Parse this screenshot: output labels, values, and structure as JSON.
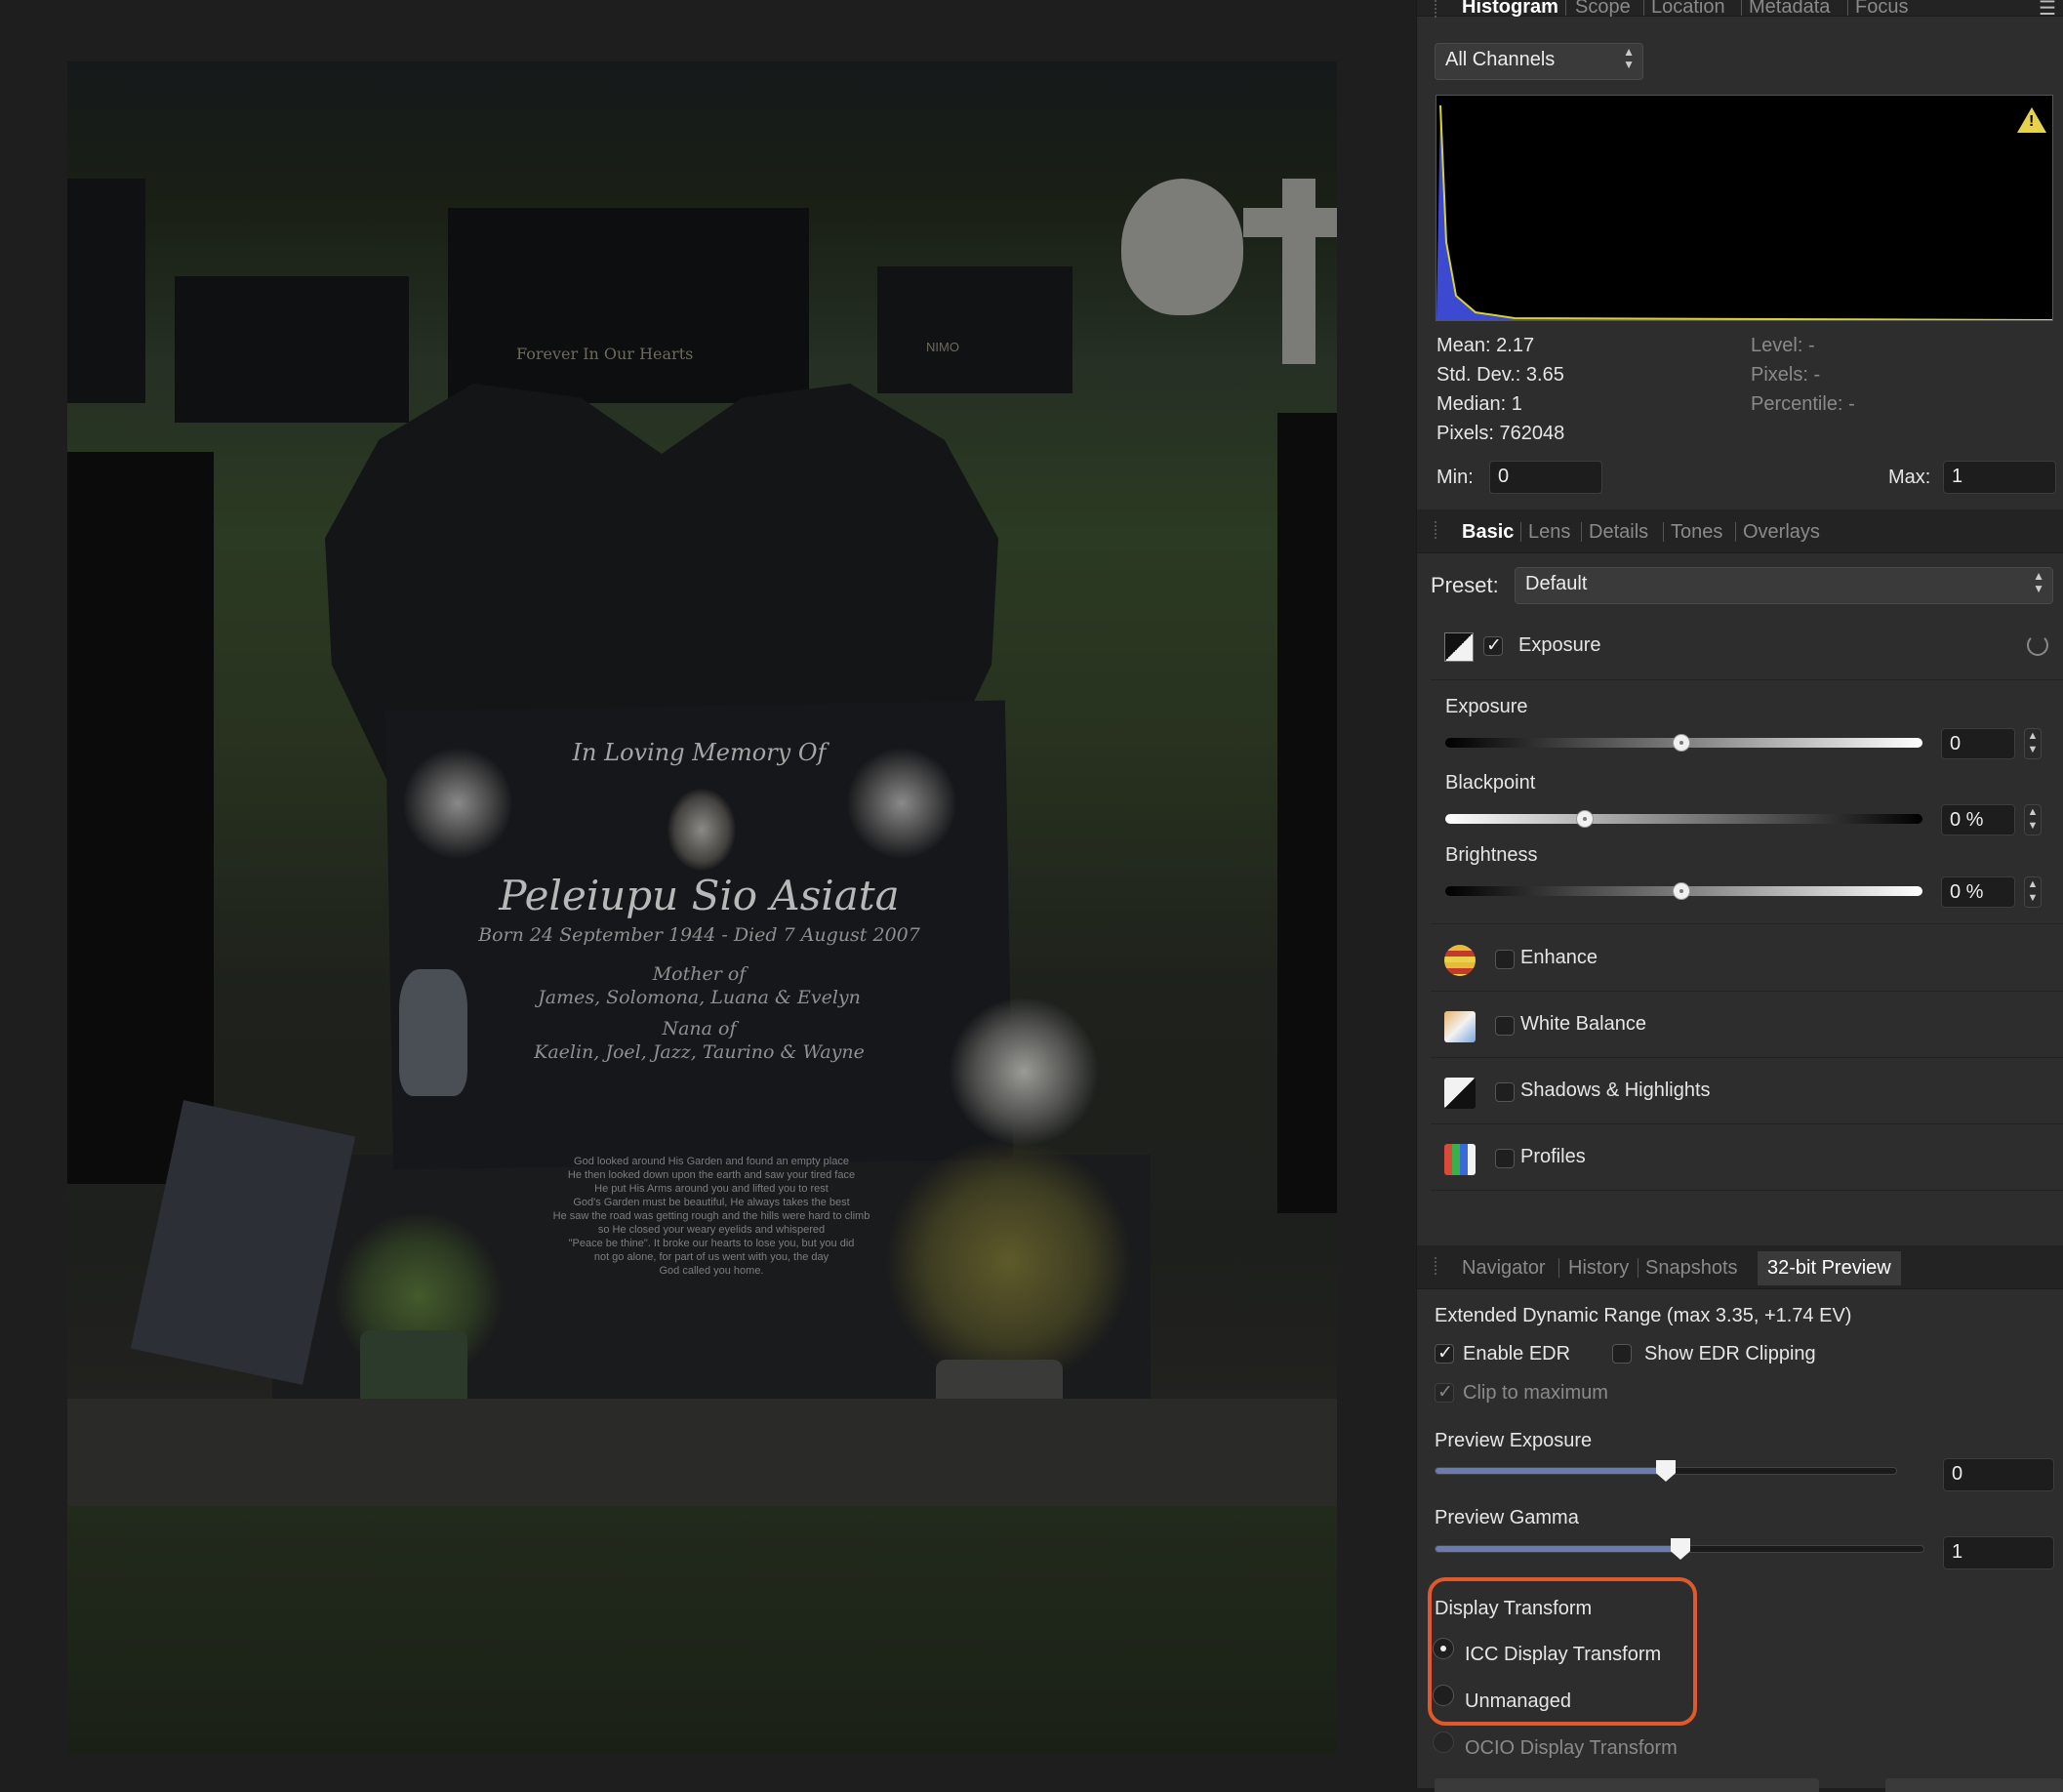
{
  "histogram": {
    "tabs": [
      "Histogram",
      "Scope",
      "Location",
      "Metadata",
      "Focus"
    ],
    "channel": "All Channels",
    "stats_left": [
      {
        "label": "Mean:",
        "value": "2.17"
      },
      {
        "label": "Std. Dev.:",
        "value": "3.65"
      },
      {
        "label": "Median:",
        "value": "1"
      },
      {
        "label": "Pixels:",
        "value": "762048"
      }
    ],
    "stats_right": [
      {
        "label": "Level:",
        "value": "-"
      },
      {
        "label": "Pixels:",
        "value": "-"
      },
      {
        "label": "Percentile:",
        "value": "-"
      }
    ],
    "min_label": "Min:",
    "min_value": "0",
    "max_label": "Max:",
    "max_value": "1"
  },
  "develop": {
    "tabs": [
      "Basic",
      "Lens",
      "Details",
      "Tones",
      "Overlays"
    ],
    "preset_label": "Preset:",
    "preset_value": "Default",
    "exposure_group": {
      "label": "Exposure",
      "enabled": true,
      "sliders": [
        {
          "label": "Exposure",
          "value": "0",
          "level": 0.5
        },
        {
          "label": "Blackpoint",
          "value": "0 %",
          "level": 0.295
        },
        {
          "label": "Brightness",
          "value": "0 %",
          "level": 0.5
        }
      ]
    },
    "groups": [
      {
        "label": "Enhance",
        "enabled": false,
        "icon": "enhance-icon"
      },
      {
        "label": "White Balance",
        "enabled": false,
        "icon": "white-balance-icon"
      },
      {
        "label": "Shadows & Highlights",
        "enabled": false,
        "icon": "shadows-highlights-icon"
      },
      {
        "label": "Profiles",
        "enabled": false,
        "icon": "profiles-icon"
      }
    ]
  },
  "preview": {
    "tabs": [
      "Navigator",
      "History",
      "Snapshots",
      "32-bit Preview"
    ],
    "edr_title": "Extended Dynamic Range (max 3.35, +1.74 EV)",
    "enable_edr": "Enable EDR",
    "show_edr_clipping": "Show EDR Clipping",
    "clip_to_maximum": "Clip to maximum",
    "preview_exposure_label": "Preview Exposure",
    "preview_exposure_value": "0",
    "preview_exposure_level": 0.5,
    "preview_gamma_label": "Preview Gamma",
    "preview_gamma_value": "1",
    "preview_gamma_level": 0.5,
    "display_transform_label": "Display Transform",
    "options": [
      "ICC Display Transform",
      "Unmanaged",
      "OCIO Display Transform"
    ],
    "selected_option": "ICC Display Transform"
  },
  "photo": {
    "header": "In Loving Memory Of",
    "name": "Peleiupu Sio Asiata",
    "dates": "Born 24 September 1944 - Died 7 August 2007",
    "mother_of": "Mother of",
    "children": "James, Solomona, Luana & Evelyn",
    "nana_of": "Nana of",
    "grandchildren": "Kaelin, Joel, Jazz, Taurino & Wayne",
    "poem": [
      "God looked around His Garden and found an empty place",
      "He then looked down upon the earth and saw your tired face",
      "He put His Arms around you and lifted you to rest",
      "God's Garden must be beautiful, He always takes the best",
      "He saw the road was getting rough and the hills were hard to climb",
      "so He closed your weary eyelids and whispered",
      "\"Peace be thine\". It broke our hearts to lose you, but you did",
      "not go alone, for part of us went with you, the day",
      "God called you home."
    ],
    "bg_sign_1": "Forever In Our Hearts",
    "bg_sign_2": "NIMO"
  },
  "colors": {
    "accent_highlight": "#e0592a",
    "panel_bg": "#2d2d2d",
    "histogram_yellow": "#d8d23a",
    "histogram_blue": "#3b4ad0"
  }
}
